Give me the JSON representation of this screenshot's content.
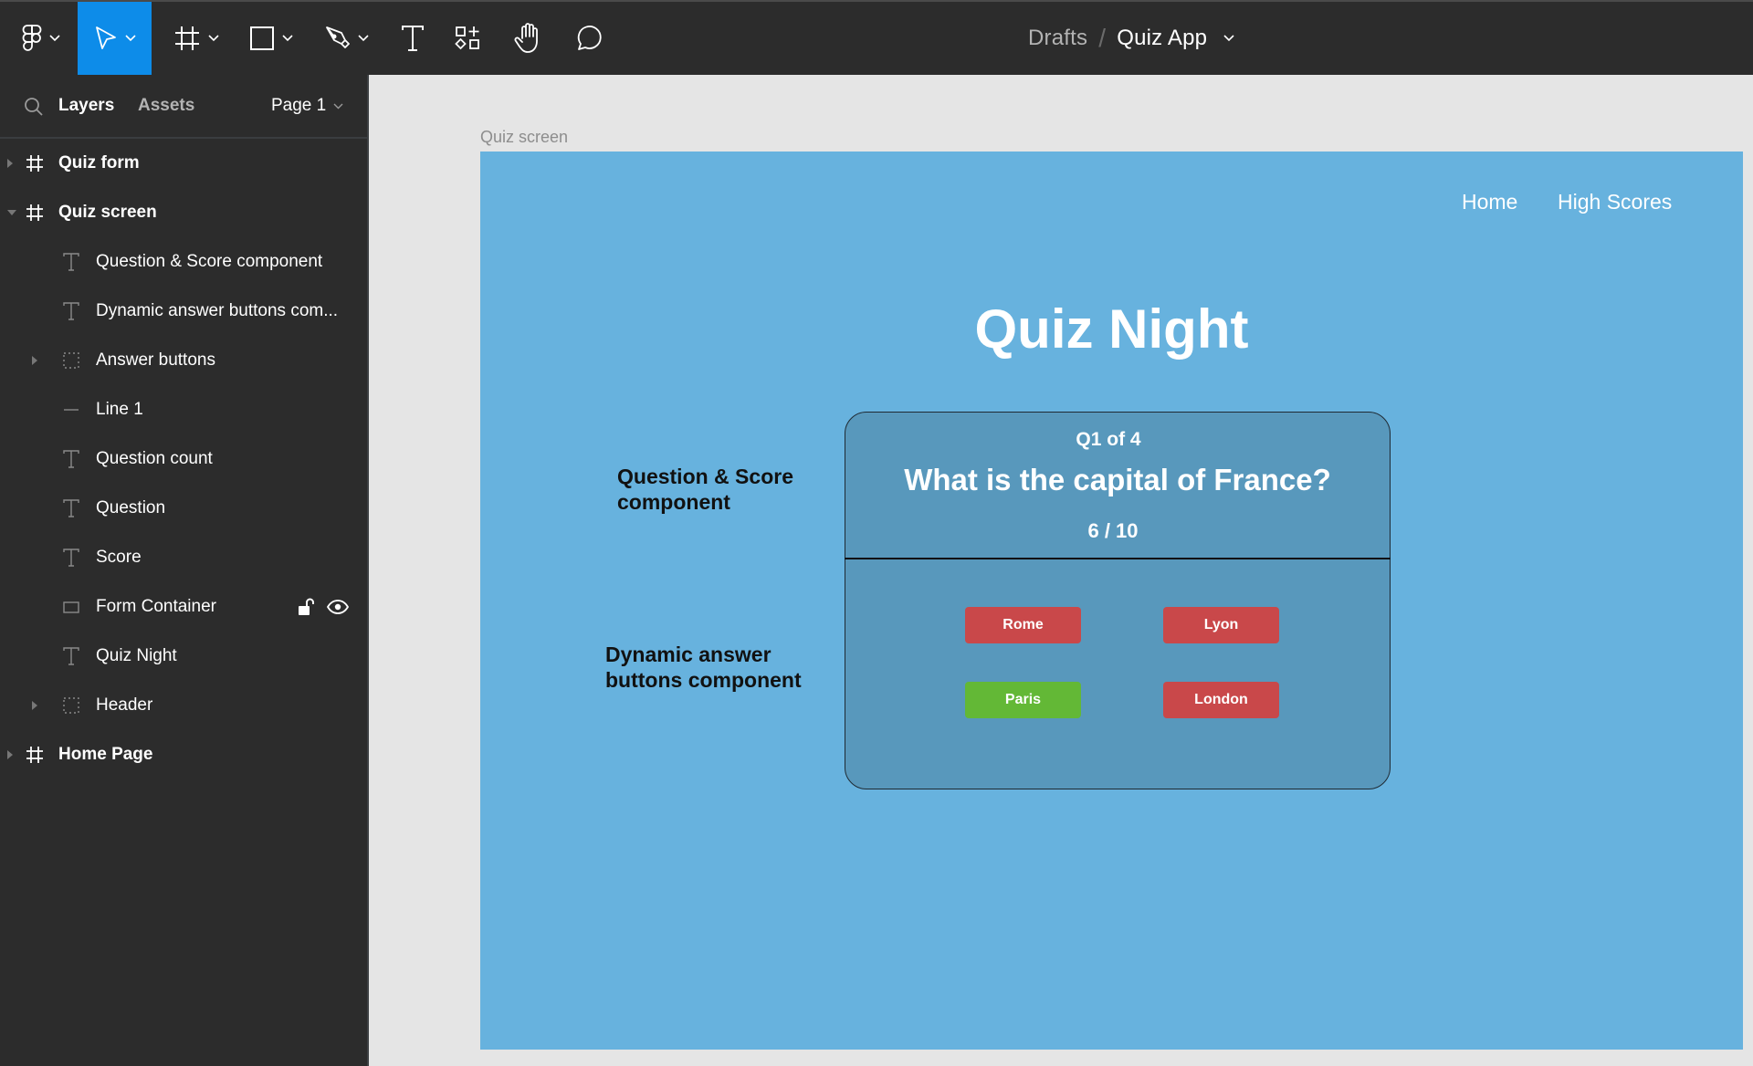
{
  "toolbar": {
    "tools": [
      {
        "name": "main-menu",
        "icon": "figma-logo-icon",
        "has_dropdown": true
      },
      {
        "name": "move",
        "icon": "move-arrow-icon",
        "has_dropdown": true,
        "active": true
      },
      {
        "name": "frame",
        "icon": "frame-hash-icon",
        "has_dropdown": true
      },
      {
        "name": "shape",
        "icon": "rectangle-icon",
        "has_dropdown": true
      },
      {
        "name": "pen",
        "icon": "pen-icon",
        "has_dropdown": true
      },
      {
        "name": "text",
        "icon": "text-icon",
        "has_dropdown": false
      },
      {
        "name": "resources",
        "icon": "components-icon",
        "has_dropdown": false
      },
      {
        "name": "hand",
        "icon": "hand-icon",
        "has_dropdown": false
      },
      {
        "name": "comment",
        "icon": "comment-icon",
        "has_dropdown": false
      }
    ],
    "active_color": "#0d8ce9",
    "breadcrumb": {
      "project": "Drafts",
      "separator": "/",
      "file": "Quiz App"
    }
  },
  "sidebar": {
    "tabs": {
      "layers": "Layers",
      "assets": "Assets"
    },
    "page": "Page 1",
    "layers": [
      {
        "label": "Quiz form",
        "type": "frame",
        "level": 0,
        "expanded": false
      },
      {
        "label": "Quiz screen",
        "type": "frame",
        "level": 0,
        "expanded": true
      },
      {
        "label": "Question & Score component",
        "type": "text",
        "level": 1
      },
      {
        "label": "Dynamic answer buttons com...",
        "type": "text",
        "level": 1
      },
      {
        "label": "Answer buttons",
        "type": "group",
        "level": 1,
        "expanded": false
      },
      {
        "label": "Line 1",
        "type": "line",
        "level": 1
      },
      {
        "label": "Question count",
        "type": "text",
        "level": 1
      },
      {
        "label": "Question",
        "type": "text",
        "level": 1
      },
      {
        "label": "Score",
        "type": "text",
        "level": 1
      },
      {
        "label": "Form Container",
        "type": "rectangle",
        "level": 1,
        "hovered": true
      },
      {
        "label": "Quiz Night",
        "type": "text",
        "level": 1
      },
      {
        "label": "Header",
        "type": "group",
        "level": 1,
        "expanded": false
      },
      {
        "label": "Home Page",
        "type": "frame",
        "level": 0,
        "expanded": false
      }
    ]
  },
  "canvas": {
    "frame_label": "Quiz screen",
    "frame_bg": "#67b2de",
    "nav": {
      "home": "Home",
      "high_scores": "High Scores"
    },
    "title": "Quiz Night",
    "annotations": {
      "question_score": "Question & Score\ncomponent",
      "dynamic_buttons": "Dynamic answer\nbuttons component"
    },
    "card": {
      "count": "Q1 of 4",
      "question": "What is the capital of France?",
      "score": "6 / 10",
      "answers": [
        {
          "label": "Rome",
          "status": "wrong",
          "color": "#c9484a"
        },
        {
          "label": "Lyon",
          "status": "wrong",
          "color": "#c9484a"
        },
        {
          "label": "Paris",
          "status": "correct",
          "color": "#63b836"
        },
        {
          "label": "London",
          "status": "wrong",
          "color": "#c9484a"
        }
      ]
    }
  }
}
